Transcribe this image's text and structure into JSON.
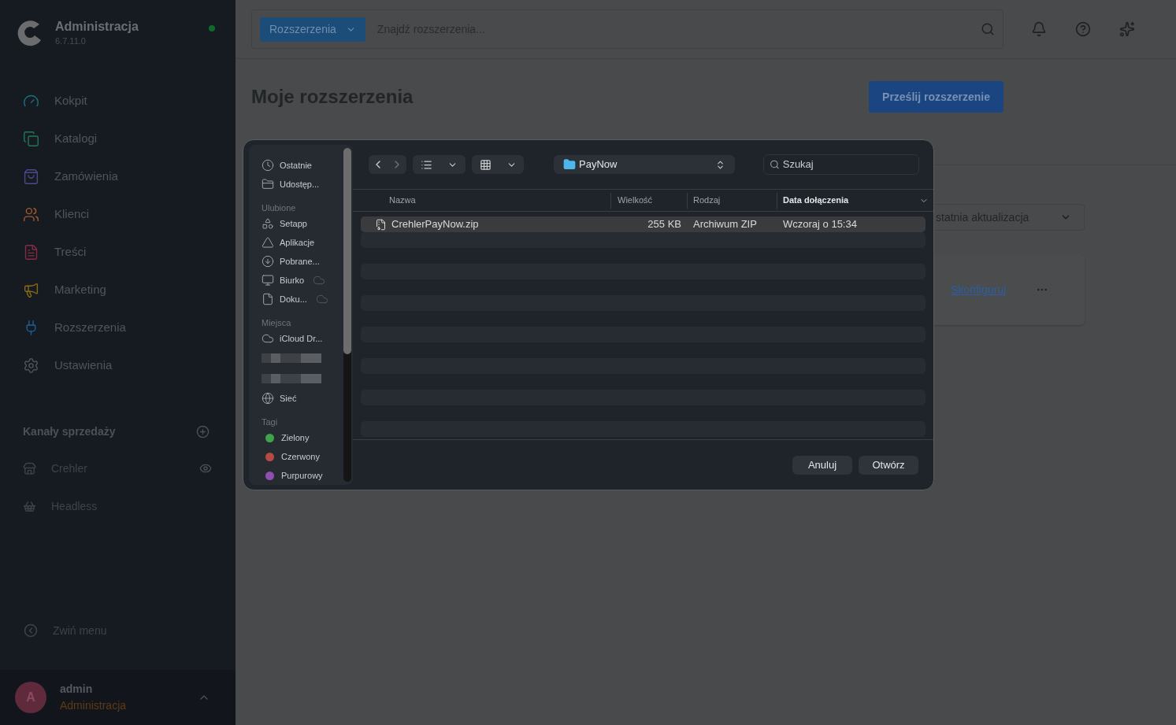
{
  "sidebar": {
    "brand": {
      "title": "Administracja",
      "version": "6.7.11.0"
    },
    "nav": [
      {
        "label": "Kokpit",
        "color": "#1f6f80"
      },
      {
        "label": "Katalogi",
        "color": "#1e7a55"
      },
      {
        "label": "Zamówienia",
        "color": "#4c4a8a"
      },
      {
        "label": "Klienci",
        "color": "#a35a2a"
      },
      {
        "label": "Treści",
        "color": "#8a2a45"
      },
      {
        "label": "Marketing",
        "color": "#8a6a12"
      },
      {
        "label": "Rozszerzenia",
        "color": "#1d5f96"
      },
      {
        "label": "Ustawienia",
        "color": "#50555c"
      }
    ],
    "sales_channels": {
      "title": "Kanały sprzedaży",
      "items": [
        {
          "label": "Crehler",
          "kind": "storefront"
        },
        {
          "label": "Headless",
          "kind": "headless"
        }
      ]
    },
    "collapse": "Zwiń menu",
    "user": {
      "initial": "A",
      "name": "admin",
      "role": "Administracja"
    }
  },
  "topbar": {
    "scope": "Rozszerzenia",
    "search_placeholder": "Znajdź rozszerzenia..."
  },
  "page": {
    "title": "Moje rozszerzenia",
    "upload_button": "Prześlij rozszerzenie",
    "sort_value": "statnia aktualizacja",
    "card_link": "Skonfiguruj"
  },
  "dialog": {
    "sidebar": [
      {
        "items": [
          {
            "label": "Ostatnie",
            "cloud": false
          },
          {
            "label": "Udostęp...",
            "cloud": false
          }
        ]
      },
      {
        "title": "Ulubione",
        "items": [
          {
            "label": "Setapp",
            "cloud": false
          },
          {
            "label": "Aplikacje",
            "cloud": false
          },
          {
            "label": "Pobrane...",
            "cloud": false
          },
          {
            "label": "Biurko",
            "cloud": true
          },
          {
            "label": "Doku...",
            "cloud": true
          }
        ]
      },
      {
        "title": "Miejsca",
        "items": [
          {
            "label": "iCloud Dr...",
            "cloud": false
          },
          {
            "kind": "redacted"
          },
          {
            "kind": "redacted"
          },
          {
            "label": "Sieć",
            "cloud": false
          }
        ]
      },
      {
        "title": "Tagi",
        "items": [
          {
            "label": "Zielony",
            "color": "#3fa34d"
          },
          {
            "label": "Czerwony",
            "color": "#b84a45"
          },
          {
            "label": "Purpurowy",
            "color": "#8e4fb0"
          }
        ]
      }
    ],
    "folder": "PayNow",
    "search_placeholder": "Szukaj",
    "columns": [
      {
        "label": "Nazwa",
        "sorted": false
      },
      {
        "label": "Wielkość",
        "sorted": false
      },
      {
        "label": "Rodzaj",
        "sorted": false
      },
      {
        "label": "Data dołączenia",
        "sorted": true
      }
    ],
    "rows": [
      {
        "name": "CrehlerPayNow.zip",
        "size": "255 KB",
        "type": "Archiwum ZIP",
        "date": "Wczoraj o 15:34",
        "selected": true
      }
    ],
    "buttons": [
      "Anuluj",
      "Otwórz"
    ]
  }
}
